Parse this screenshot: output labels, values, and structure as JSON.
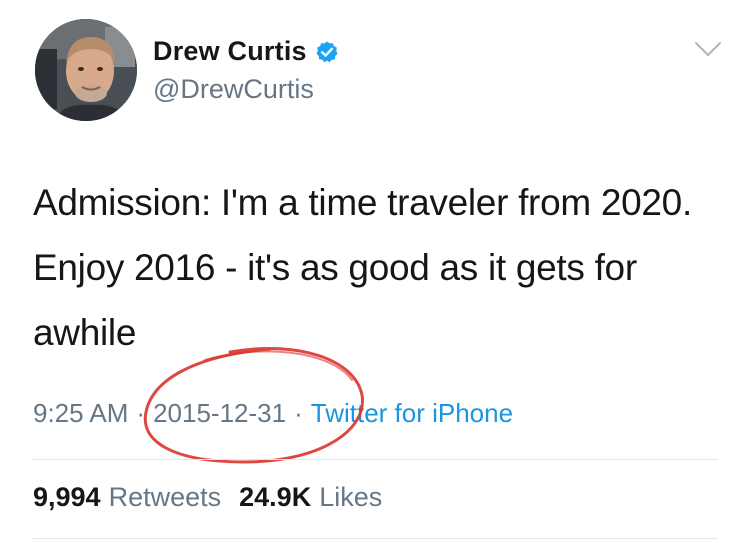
{
  "author": {
    "display_name": "Drew Curtis",
    "handle": "@DrewCurtis",
    "verified": true
  },
  "tweet": {
    "text": "Admission: I'm a time traveler from 2020. Enjoy 2016 - it's as good as it gets for awhile"
  },
  "meta": {
    "time": "9:25 AM",
    "separator": "·",
    "date": "2015-12-31",
    "source": "Twitter for iPhone"
  },
  "stats": {
    "retweets_count": "9,994",
    "retweets_label": "Retweets",
    "likes_count": "24.9K",
    "likes_label": "Likes"
  },
  "icons": {
    "verified": "verified-badge-icon",
    "caret": "chevron-down-icon"
  },
  "colors": {
    "name": "#14171a",
    "secondary": "#657786",
    "link": "#1b95e0",
    "verified": "#1da1f2",
    "annotation": "#d9342b",
    "divider": "#e1e8ed"
  }
}
